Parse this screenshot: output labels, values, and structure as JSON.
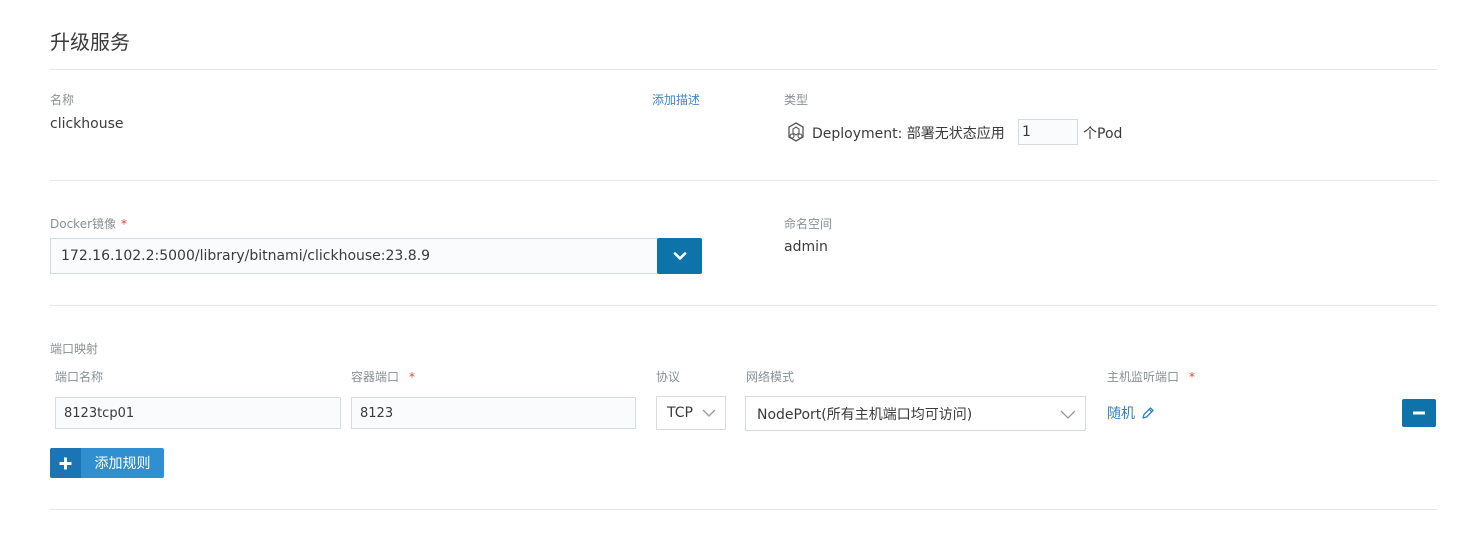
{
  "page": {
    "title": "升级服务"
  },
  "name_section": {
    "label": "名称",
    "value": "clickhouse",
    "add_desc_link": "添加描述"
  },
  "type_section": {
    "label": "类型",
    "deployment_text": "Deployment: 部署无状态应用",
    "replicas": "1",
    "unit": "个Pod"
  },
  "image_section": {
    "label": "Docker镜像",
    "required_mark": "*",
    "value": "172.16.102.2:5000/library/bitnami/clickhouse:23.8.9"
  },
  "namespace_section": {
    "label": "命名空间",
    "value": "admin"
  },
  "ports": {
    "section_label": "端口映射",
    "headers": {
      "name": "端口名称",
      "container_port": "容器端口",
      "protocol": "协议",
      "network_mode": "网络模式",
      "host_port": "主机监听端口"
    },
    "required_mark": "*",
    "rows": [
      {
        "name": "8123tcp01",
        "container_port": "8123",
        "protocol": "TCP",
        "network_mode": "NodePort(所有主机端口均可访问)",
        "host_port": "随机"
      }
    ],
    "add_rule_label": "添加规则"
  },
  "colors": {
    "primary": "#0e73a8",
    "add_button": "#2f8fd1",
    "link": "#3d86c6",
    "required": "#e1463a"
  }
}
